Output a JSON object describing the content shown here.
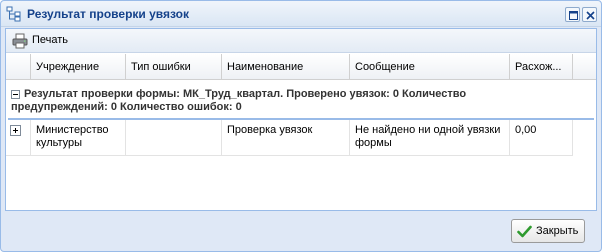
{
  "window": {
    "title": "Результат проверки увязок",
    "icon": "tree-structure-icon"
  },
  "toolbar": {
    "print_label": "Печать",
    "print_icon": "printer-icon"
  },
  "grid": {
    "columns": [
      "Учреждение",
      "Тип ошибки",
      "Наименование",
      "Сообщение",
      "Расхож..."
    ],
    "group": {
      "text": "Результат проверки формы: МК_Труд_квартал. Проверено увязок: 0 Количество предупреждений: 0 Количество ошибок: 0"
    },
    "rows": [
      {
        "institution": "Министерство культуры",
        "error_type": "",
        "name": "Проверка увязок",
        "message": "Не найдено ни одной увязки формы",
        "discrepancy": "0,00"
      }
    ]
  },
  "footer": {
    "close_label": "Закрыть",
    "close_icon": "checkmark-icon"
  },
  "colors": {
    "title_text": "#15428b",
    "frame_border": "#99bbe8",
    "window_bg": "#dfe8f6"
  }
}
